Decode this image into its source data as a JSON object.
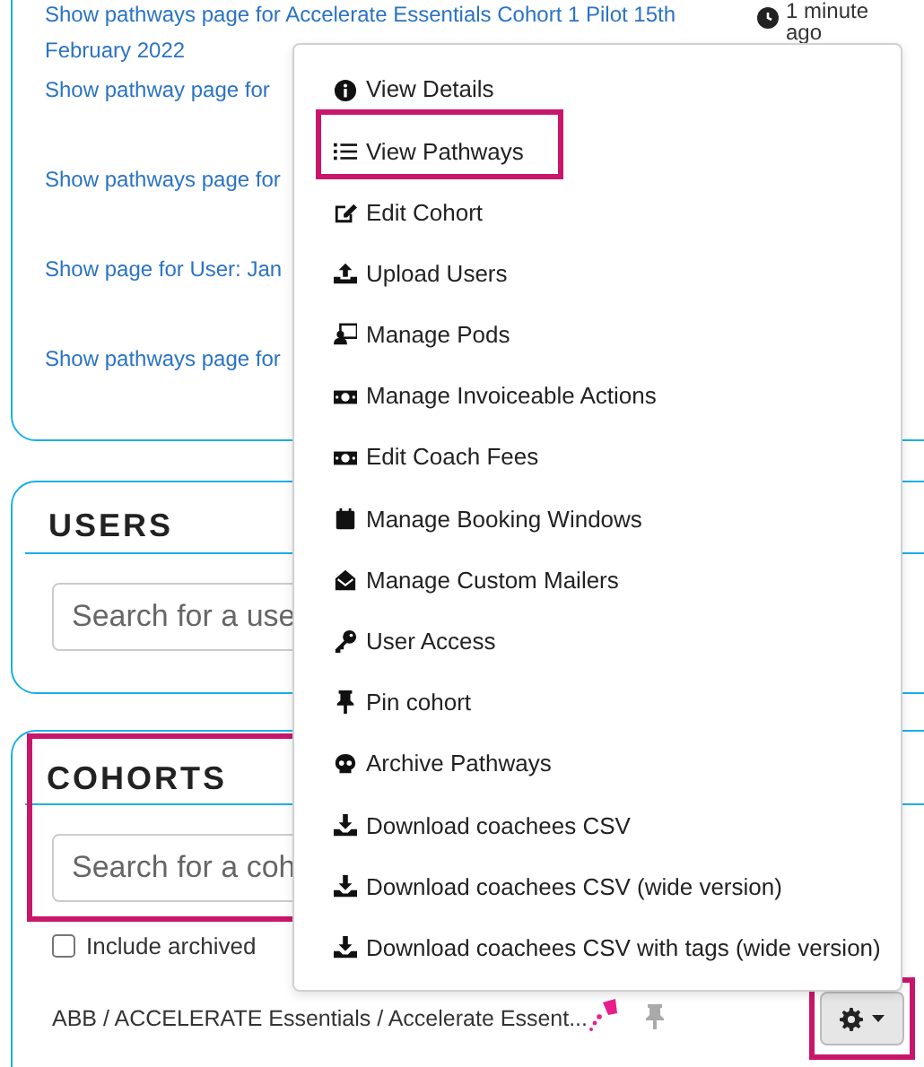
{
  "activity": {
    "first_link": "Show pathways page for Accelerate Essentials Cohort 1 Pilot 15th February 2022",
    "time": "1 minute",
    "time_suffix": "ago",
    "links": [
      "Show pathway page for",
      "Show pathways page for",
      "Show page for User: Jan",
      "Show pathways page for"
    ]
  },
  "users": {
    "title": "USERS",
    "search": {
      "placeholder": "Search for a use"
    }
  },
  "cohorts": {
    "title": "COHORTS",
    "highlighted": true,
    "search": {
      "placeholder": "Search for a coh"
    },
    "include_archived": {
      "label": "Include archived",
      "checked": false
    },
    "row": {
      "name": "ABB / ACCELERATE Essentials / Accelerate Essent...",
      "pinned": false
    },
    "gear_highlighted": true
  },
  "menu": [
    {
      "label": "View Details",
      "kind": "info",
      "highlighted": false
    },
    {
      "label": "View Pathways",
      "kind": "list",
      "highlighted": true
    },
    {
      "label": "Edit Cohort",
      "kind": "edit",
      "highlighted": false
    },
    {
      "label": "Upload Users",
      "kind": "upload",
      "highlighted": false
    },
    {
      "label": "Manage Pods",
      "kind": "pods",
      "highlighted": false
    },
    {
      "label": "Manage Invoiceable Actions",
      "kind": "money",
      "highlighted": false
    },
    {
      "label": "Edit Coach Fees",
      "kind": "money",
      "highlighted": false
    },
    {
      "label": "Manage Booking Windows",
      "kind": "calendar",
      "highlighted": false
    },
    {
      "label": "Manage Custom Mailers",
      "kind": "mail",
      "highlighted": false
    },
    {
      "label": "User Access",
      "kind": "key",
      "highlighted": false
    },
    {
      "label": "Pin cohort",
      "kind": "pin",
      "highlighted": false
    },
    {
      "label": "Archive Pathways",
      "kind": "skull",
      "highlighted": false
    },
    {
      "label": "Download coachees CSV",
      "kind": "download",
      "highlighted": false
    },
    {
      "label": "Download coachees CSV (wide version)",
      "kind": "download",
      "highlighted": false
    },
    {
      "label": "Download coachees CSV with tags (wide version)",
      "kind": "download",
      "highlighted": false
    }
  ]
}
